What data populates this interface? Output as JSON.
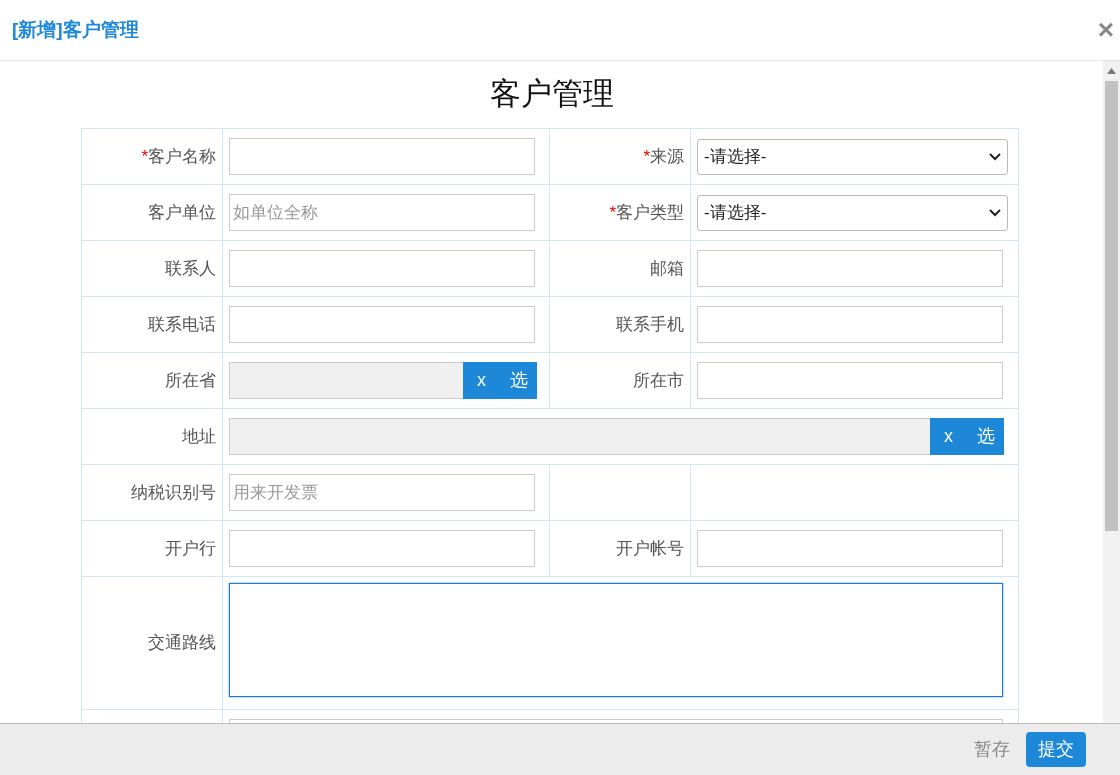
{
  "dialog": {
    "title": "[新增]客户管理",
    "close": "×"
  },
  "form": {
    "title": "客户管理",
    "rows": [
      {
        "cells": [
          {
            "marker": "*",
            "label": "客户名称",
            "field": {
              "kind": "text"
            }
          },
          {
            "marker": "*",
            "label": "来源",
            "field": {
              "kind": "select",
              "value": "-请选择-"
            }
          }
        ]
      },
      {
        "cells": [
          {
            "label": "客户单位",
            "field": {
              "kind": "text",
              "placeholder": "如单位全称"
            }
          },
          {
            "marker": "*",
            "label": "客户类型",
            "field": {
              "kind": "select",
              "value": "-请选择-"
            }
          }
        ]
      },
      {
        "cells": [
          {
            "label": "联系人",
            "field": {
              "kind": "text"
            }
          },
          {
            "label": "邮箱",
            "field": {
              "kind": "text"
            }
          }
        ]
      },
      {
        "cells": [
          {
            "label": "联系电话",
            "field": {
              "kind": "text"
            }
          },
          {
            "label": "联系手机",
            "field": {
              "kind": "text"
            }
          }
        ]
      },
      {
        "cells": [
          {
            "label": "所在省",
            "field": {
              "kind": "picker",
              "clear": "x",
              "choose": "选"
            }
          },
          {
            "label": "所在市",
            "field": {
              "kind": "text"
            }
          }
        ]
      },
      {
        "cells": [
          {
            "label": "地址",
            "field": {
              "kind": "picker",
              "clear": "x",
              "choose": "选"
            }
          }
        ]
      },
      {
        "cells": [
          {
            "label": "纳税识别号",
            "field": {
              "kind": "text",
              "placeholder": "用来开发票"
            }
          },
          {
            "field": {
              "kind": "none"
            }
          }
        ]
      },
      {
        "cells": [
          {
            "label": "开户行",
            "field": {
              "kind": "text"
            }
          },
          {
            "label": "开户帐号",
            "field": {
              "kind": "text"
            }
          }
        ]
      },
      {
        "cells": [
          {
            "label": "交通路线",
            "field": {
              "kind": "textarea",
              "focused": true
            }
          }
        ]
      },
      {
        "cells": [
          {
            "field": {
              "kind": "text"
            }
          }
        ]
      }
    ]
  },
  "footer": {
    "buttons": [
      {
        "label": "暂存",
        "kind": "plain"
      },
      {
        "label": "提交",
        "kind": "primary"
      }
    ]
  }
}
